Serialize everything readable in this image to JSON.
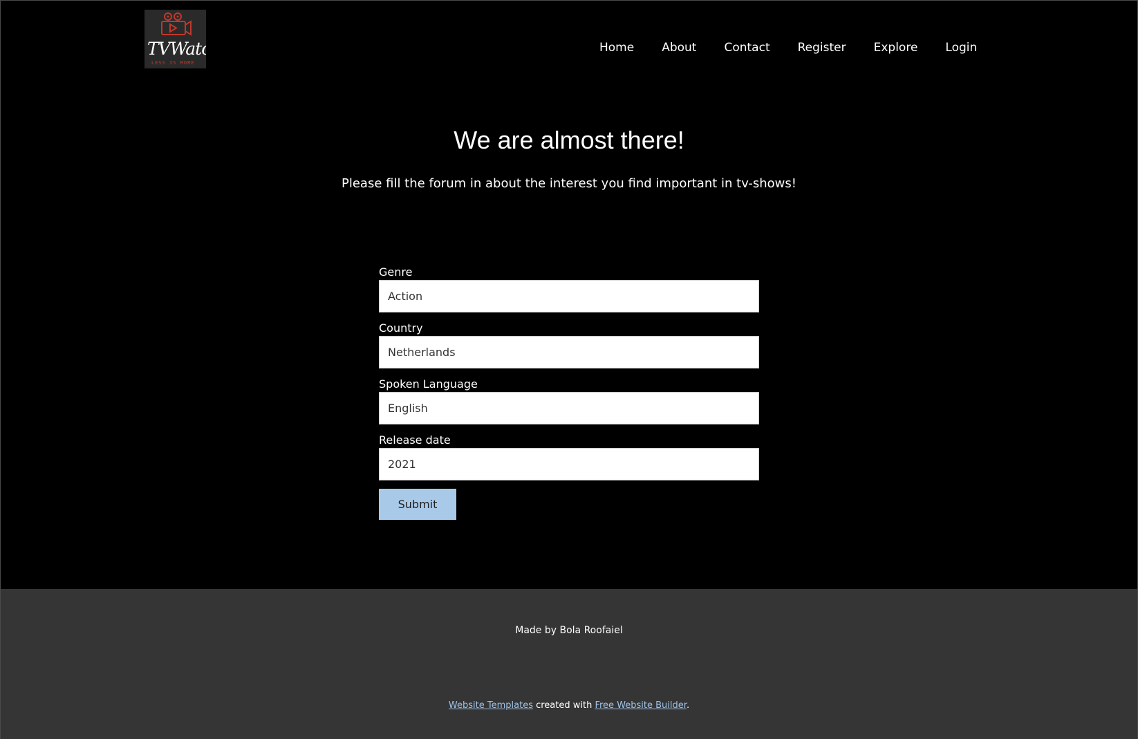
{
  "brand": {
    "name": "TVWatch",
    "tagline": "LESS IS MORE"
  },
  "nav": {
    "items": [
      "Home",
      "About",
      "Contact",
      "Register",
      "Explore",
      "Login"
    ]
  },
  "hero": {
    "title": "We are almost there!",
    "subtitle": "Please fill the forum in about the interest you find important in tv-shows!"
  },
  "form": {
    "fields": [
      {
        "label": "Genre",
        "value": "Action"
      },
      {
        "label": "Country",
        "value": "Netherlands"
      },
      {
        "label": "Spoken Language",
        "value": "English"
      },
      {
        "label": "Release date",
        "value": "2021"
      }
    ],
    "submit_label": "Submit"
  },
  "footer": {
    "made_by": "Made by Bola Roofaiel",
    "link1": "Website Templates",
    "middle_text": " created with ",
    "link2": "Free Website Builder",
    "end_text": "."
  },
  "colors": {
    "background": "#000000",
    "footer_bg": "#353535",
    "submit_bg": "#a9c9e9",
    "logo_accent": "#c0392b",
    "link": "#9fc3e7"
  }
}
